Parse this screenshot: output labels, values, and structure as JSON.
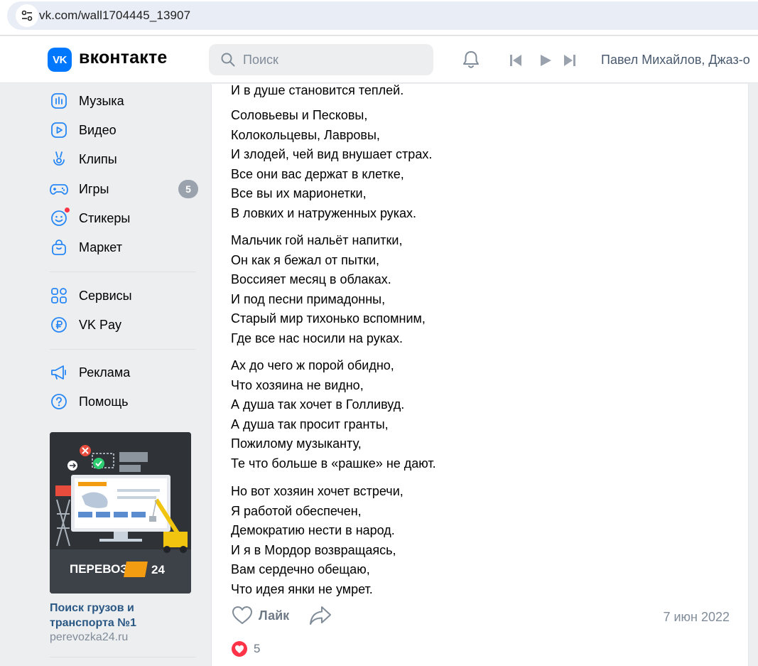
{
  "browser": {
    "url": "vk.com/wall1704445_13907"
  },
  "header": {
    "logo_glyph": "VK",
    "wordmark": "вконтакте",
    "search_placeholder": "Поиск",
    "now_playing": "Павел Михайлов, Джаз-о"
  },
  "sidebar": {
    "items": [
      {
        "label": "Музыка",
        "icon": "music-icon"
      },
      {
        "label": "Видео",
        "icon": "video-icon"
      },
      {
        "label": "Клипы",
        "icon": "clips-icon"
      },
      {
        "label": "Игры",
        "icon": "games-icon",
        "badge": "5"
      },
      {
        "label": "Стикеры",
        "icon": "stickers-icon"
      },
      {
        "label": "Маркет",
        "icon": "market-icon"
      },
      {
        "label": "Сервисы",
        "icon": "services-icon"
      },
      {
        "label": "VK Pay",
        "icon": "vkpay-icon"
      },
      {
        "label": "Реклама",
        "icon": "ads-icon"
      },
      {
        "label": "Помощь",
        "icon": "help-icon"
      }
    ],
    "ad": {
      "brand_text": "ПЕРЕВОЗКА",
      "brand_number": "24",
      "title": "Поиск грузов и транспорта №1",
      "domain": "perevozka24.ru"
    }
  },
  "post": {
    "stanzas": [
      [
        "И в душе становится теплей."
      ],
      [
        "Соловьевы и Песковы,",
        "Колокольцевы, Лавровы,",
        "И злодей, чей вид внушает страх.",
        "Все они вас держат в клетке,",
        "Все вы их марионетки,",
        "В ловких и натруженных руках."
      ],
      [
        "Мальчик гой нальёт напитки,",
        "Он как я бежал от пытки,",
        "Воссияет месяц в облаках.",
        "И под песни примадонны,",
        "Старый мир тихонько вспомним,",
        "Где все нас носили на руках."
      ],
      [
        "Ах до чего ж порой обидно,",
        "Что хозяина не видно,",
        "А душа так хочет в Голливуд.",
        "А душа так просит гранты,",
        "Пожилому музыканту,",
        "Те что больше в «рашке» не дают."
      ],
      [
        "Но вот хозяин хочет встречи,",
        "Я работой обеспечен,",
        "Демократию нести в народ.",
        "И я в Мордор возвращаясь,",
        "Вам сердечно обещаю,",
        "Что идея янки не умрет."
      ]
    ],
    "like_label": "Лайк",
    "date": "7 июн 2022",
    "reaction_count": "5",
    "colors": {
      "accent": "#0077ff",
      "heart": "#ff3347",
      "link": "#2a5885"
    }
  }
}
